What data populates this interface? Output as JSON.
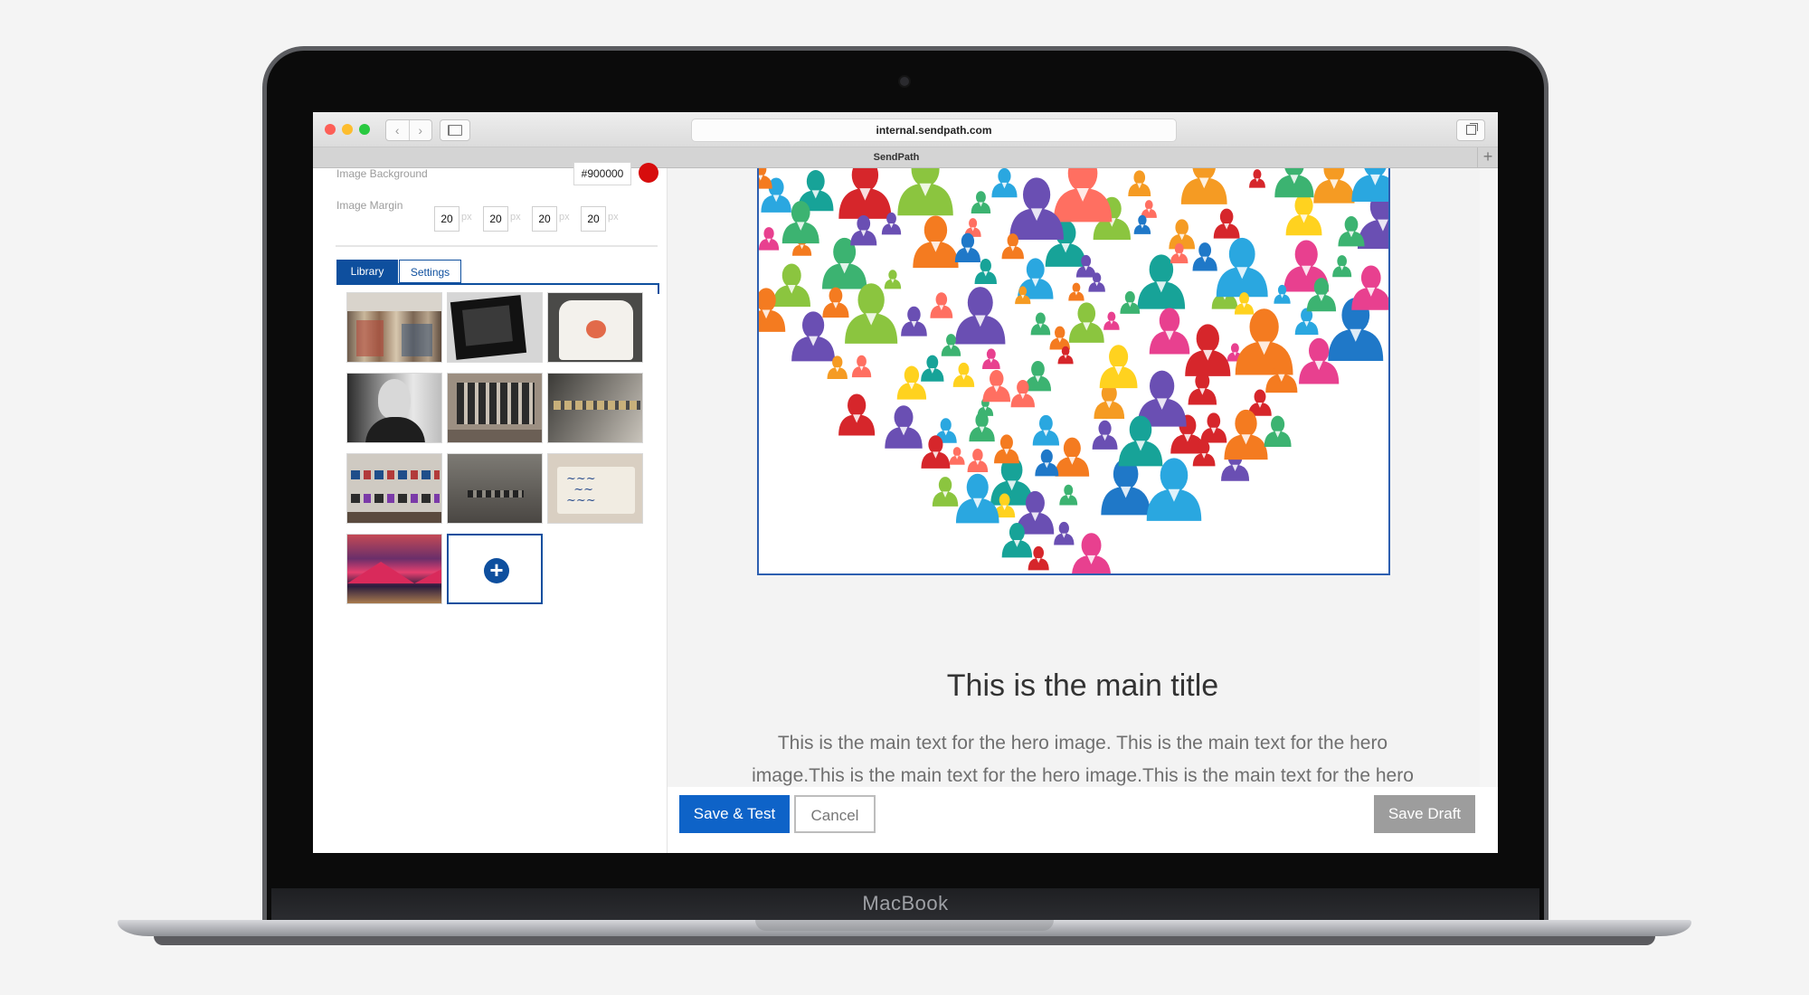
{
  "device": {
    "brand": "MacBook"
  },
  "browser": {
    "url": "internal.sendpath.com",
    "tab_title": "SendPath",
    "new_tab_glyph": "+",
    "back_glyph": "‹",
    "forward_glyph": "›"
  },
  "editor": {
    "image_background": {
      "label": "Image Background",
      "value": "#900000",
      "swatch_color": "#d70d0d"
    },
    "image_margin": {
      "label": "Image Margin",
      "values": [
        "20",
        "20",
        "20",
        "20"
      ],
      "unit": "px"
    },
    "tabs": {
      "library": "Library",
      "settings": "Settings"
    },
    "library_count": 10,
    "add_glyph": "+"
  },
  "preview": {
    "title": "This is the main title",
    "text": "This is the main text for the hero image. This is the main text for the hero image.This is the main text for the hero image.This is the main text for the hero image."
  },
  "footer": {
    "save_test": "Save & Test",
    "cancel": "Cancel",
    "save_draft": "Save Draft"
  },
  "colors": {
    "accent": "#0e4f9e",
    "primary_button": "#0e63c8",
    "draft_button": "#9d9d9d"
  }
}
